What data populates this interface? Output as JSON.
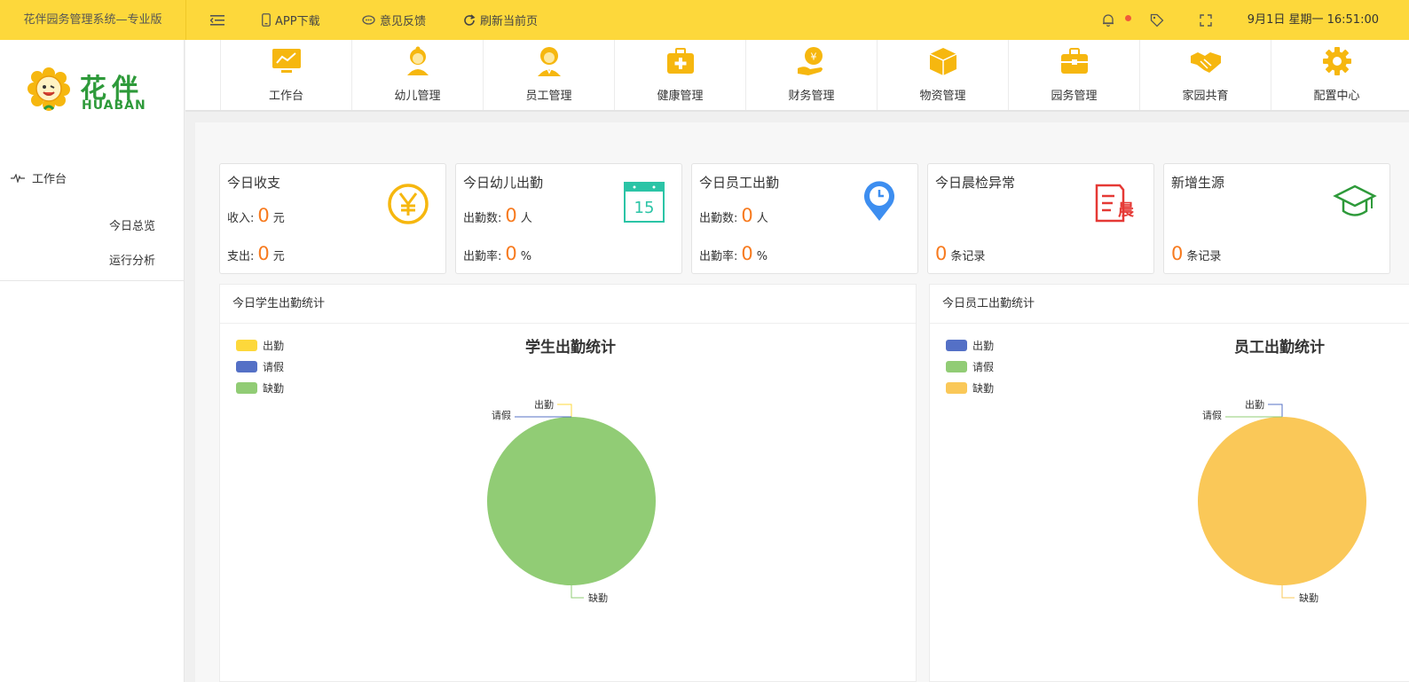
{
  "app": {
    "title": "花伴园务管理系统—专业版"
  },
  "toolbar": {
    "app_download": "APP下载",
    "feedback": "意见反馈",
    "refresh": "刷新当前页",
    "clock": "9月1日 星期一 16:51:00"
  },
  "logo": {
    "cn": "花伴",
    "en": "HUABAN"
  },
  "sidebar": {
    "group_label": "工作台",
    "items": [
      {
        "label": "今日总览"
      },
      {
        "label": "运行分析"
      }
    ]
  },
  "modules": [
    {
      "label": "工作台",
      "icon": "monitor-chart-icon"
    },
    {
      "label": "幼儿管理",
      "icon": "child-icon"
    },
    {
      "label": "员工管理",
      "icon": "staff-icon"
    },
    {
      "label": "健康管理",
      "icon": "medical-kit-icon"
    },
    {
      "label": "财务管理",
      "icon": "yuan-hand-icon"
    },
    {
      "label": "物资管理",
      "icon": "box-icon"
    },
    {
      "label": "园务管理",
      "icon": "briefcase-icon"
    },
    {
      "label": "家园共育",
      "icon": "handshake-icon"
    },
    {
      "label": "配置中心",
      "icon": "gear-icon"
    }
  ],
  "cards": {
    "income": {
      "title": "今日收支",
      "in_label": "收入:",
      "in_value": "0",
      "in_unit": "元",
      "out_label": "支出:",
      "out_value": "0",
      "out_unit": "元"
    },
    "child_attendance": {
      "title": "今日幼儿出勤",
      "count_label": "出勤数:",
      "count_value": "0",
      "count_unit": "人",
      "rate_label": "出勤率:",
      "rate_value": "0",
      "rate_unit": "%",
      "calendar_day": "15"
    },
    "staff_attendance": {
      "title": "今日员工出勤",
      "count_label": "出勤数:",
      "count_value": "0",
      "count_unit": "人",
      "rate_label": "出勤率:",
      "rate_value": "0",
      "rate_unit": "%"
    },
    "morning_check": {
      "title": "今日晨检异常",
      "value": "0",
      "unit": "条记录",
      "icon_text": "晨"
    },
    "new_students": {
      "title": "新增生源",
      "value": "0",
      "unit": "条记录"
    }
  },
  "colors": {
    "topbar": "#fdd83b",
    "accent_number": "#f77a1e",
    "logo_green": "#2e9a3a",
    "module_icon": "#f6b70f"
  },
  "panels": {
    "student": {
      "header": "今日学生出勤统计"
    },
    "staff": {
      "header": "今日员工出勤统计"
    }
  },
  "chart_data": [
    {
      "type": "pie",
      "title": "学生出勤统计",
      "legend_position": "top-left",
      "categories": [
        "出勤",
        "请假",
        "缺勤"
      ],
      "values": [
        0,
        0,
        1
      ],
      "colors": [
        "#fdd83b",
        "#5470c6",
        "#91cc75"
      ]
    },
    {
      "type": "pie",
      "title": "员工出勤统计",
      "legend_position": "top-left",
      "categories": [
        "出勤",
        "请假",
        "缺勤"
      ],
      "values": [
        0,
        0,
        1
      ],
      "colors": [
        "#5470c6",
        "#91cc75",
        "#fac858"
      ]
    }
  ]
}
